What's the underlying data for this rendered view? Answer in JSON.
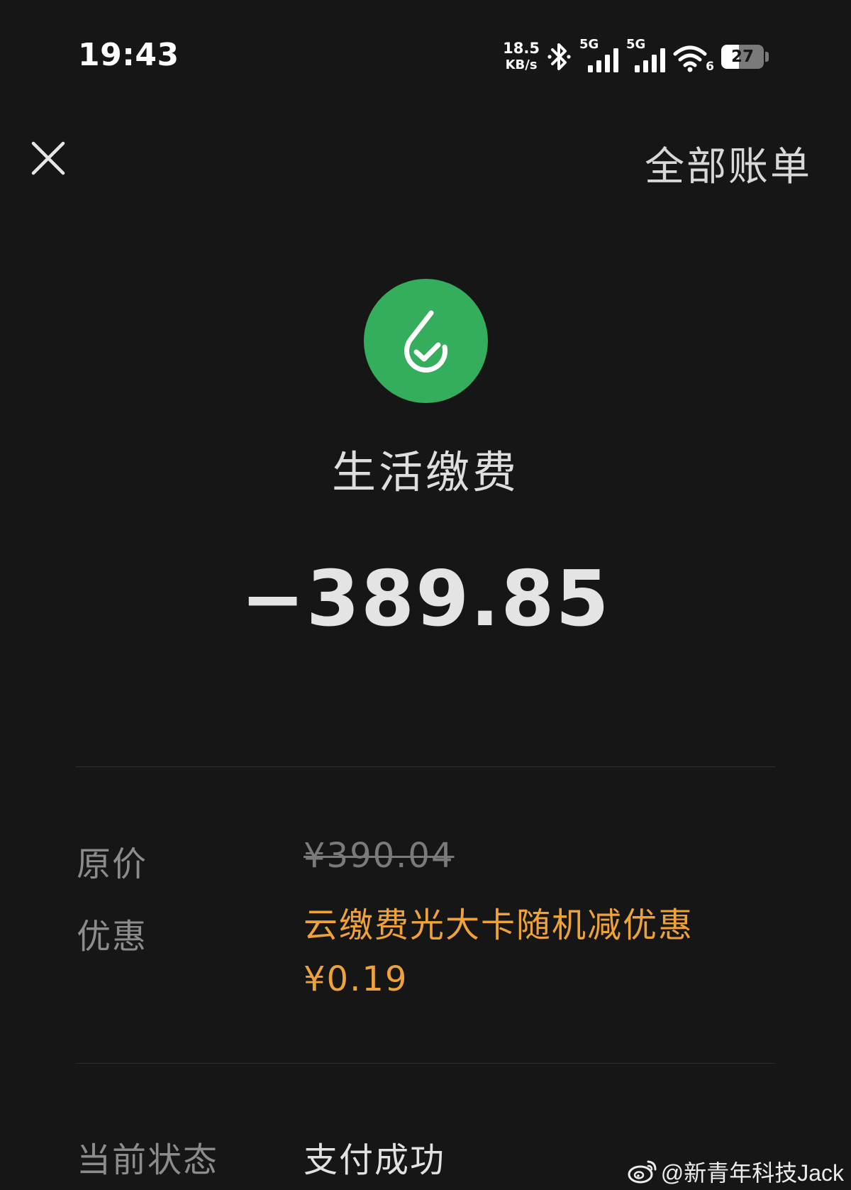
{
  "status_bar": {
    "time": "19:43",
    "net_speed_value": "18.5",
    "net_speed_unit": "KB/s",
    "sim1_label": "5G",
    "sim2_label": "5G",
    "wifi_label": "6",
    "battery_level": "27"
  },
  "nav": {
    "close_icon": "close-icon",
    "all_bills_label": "全部账单"
  },
  "header": {
    "logo_icon": "utility-payment-icon",
    "logo_color": "#34ad5c",
    "merchant": "生活缴费",
    "amount": "−389.85"
  },
  "details": {
    "original_price_label": "原价",
    "original_price_value": "¥390.04",
    "discount_label": "优惠",
    "discount_name": "云缴费光大卡随机减优惠",
    "discount_amount": "¥0.19",
    "discount_color": "#eea33a",
    "status_label": "当前状态",
    "status_value": "支付成功"
  },
  "watermark": {
    "icon": "weibo-icon",
    "text": "@新青年科技Jack"
  }
}
